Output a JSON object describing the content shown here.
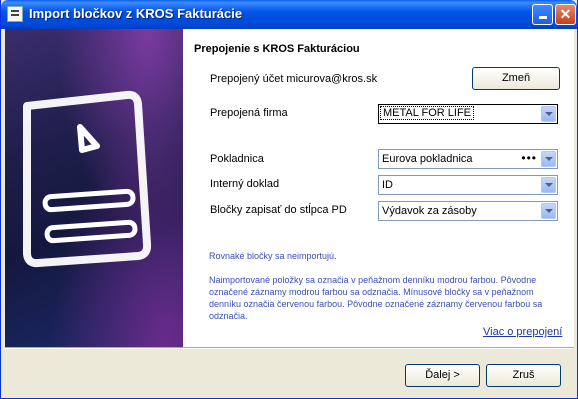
{
  "window": {
    "title": "Import bločkov z KROS Fakturácie"
  },
  "section": {
    "title": "Prepojenie s KROS Fakturáciou"
  },
  "account": {
    "label": "Prepojený účet micurova@kros.sk",
    "change_button": "Zmeň"
  },
  "company": {
    "label": "Prepojená firma",
    "value": "METAL FOR LIFE"
  },
  "cashbox": {
    "label": "Pokladnica",
    "value": "Eurova pokladnica",
    "extra": "•••"
  },
  "internal_doc": {
    "label": "Interný doklad",
    "value": "ID"
  },
  "column": {
    "label": "Bločky zapisať do stĺpca PD",
    "value": "Výdavok za zásoby"
  },
  "info": {
    "line1": "Rovnaké bločky sa neimportujú.",
    "para": [
      "Naimportované položky sa označia v peňažnom denníku modrou farbou. Pôvodne",
      "označené záznamy modrou farbou sa odznačia. Mínusové bločky sa v peňažnom",
      "denníku označia červenou farbou. Pôvodne označené záznamy červenou farbou sa",
      "odznačia."
    ]
  },
  "link": {
    "more": "Viac o prepojení"
  },
  "footer": {
    "next_button": "Ďalej >",
    "cancel_button": "Zruš"
  },
  "icons": {
    "app": "document-list-icon",
    "minimize": "minimize-icon",
    "close": "close-icon",
    "sidebar": "document-icon"
  }
}
